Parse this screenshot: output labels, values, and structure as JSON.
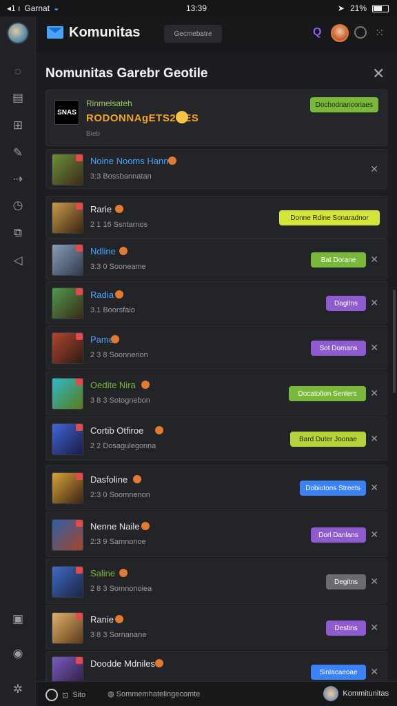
{
  "status": {
    "carrier": "Garnat",
    "signal": "◂1 ı",
    "time": "13:39",
    "battery_label": "21%"
  },
  "topbar": {
    "title": "Komunitas",
    "search_placeholder": "Gecmebatre"
  },
  "panel": {
    "title": "Nomunitas Garebr Geotile"
  },
  "featured": {
    "subtitle": "Rinmelsateh",
    "name": "RODONNAgETS2OES",
    "meta": "Bieb",
    "logo_text": "SNAS",
    "button": "Dochodnancoriaes"
  },
  "rows": [
    {
      "name": "Noine Nooms Hanms",
      "name_color": "#4aa3ff",
      "meta": "3:3 Bossbannatan",
      "button": "",
      "btn_color": ""
    },
    {
      "name": "Rarie",
      "name_color": "#e6e6e6",
      "meta": "2 1 16 Ssntarnos",
      "button": "Donne Rdine Sonaradnor",
      "btn_color": "#d4e63a"
    },
    {
      "name": "Ndline",
      "name_color": "#4aa3ff",
      "meta": "3:3 0 Sooneame",
      "button": "Bat Dorane",
      "btn_color": "#79b83a"
    },
    {
      "name": "Radia",
      "name_color": "#4aa3ff",
      "meta": "3.1 Boorsfaio",
      "button": "Dagitns",
      "btn_color": "#8e5cd0"
    },
    {
      "name": "Pame",
      "name_color": "#4aa3ff",
      "meta": "2 3 8 Soonnerion",
      "button": "Sot Domans",
      "btn_color": "#8e5cd0"
    },
    {
      "name": "Oedite Nira",
      "name_color": "#79b83a",
      "meta": "3 8 3 Sotognebon",
      "button": "Docatolton Senters",
      "btn_color": "#79b83a"
    },
    {
      "name": "Cortib Otfiroe",
      "name_color": "#e6e6e6",
      "meta": "2 2 Dosagulegonna",
      "button": "Bard Duter Joonae",
      "btn_color": "#b5d43a"
    },
    {
      "name": "Dasfoline",
      "name_color": "#e6e6e6",
      "meta": "2:3 0 Soomnenon",
      "button": "Dobiutons Streets",
      "btn_color": "#3b82f6"
    },
    {
      "name": "Nenne Naile",
      "name_color": "#e6e6e6",
      "meta": "2:3 9 Samnonoe",
      "button": "Dorl Danlans",
      "btn_color": "#8e5cd0"
    },
    {
      "name": "Saline",
      "name_color": "#79b83a",
      "meta": "2 8 3 Somnonoiea",
      "button": "Degitns",
      "btn_color": "#6b6c70"
    },
    {
      "name": "Ranie",
      "name_color": "#e6e6e6",
      "meta": "3 8 3 Sornanane",
      "button": "Destins",
      "btn_color": "#8e5cd0"
    },
    {
      "name": "Doodde Mdniles",
      "name_color": "#e6e6e6",
      "meta": "",
      "button": "Sinlacaeoae",
      "btn_color": "#3b82f6"
    }
  ],
  "bottombar": {
    "left_text": "Sito",
    "middle_text": "Sommemhatelingecomte",
    "right_text": "Kommitunitas"
  }
}
